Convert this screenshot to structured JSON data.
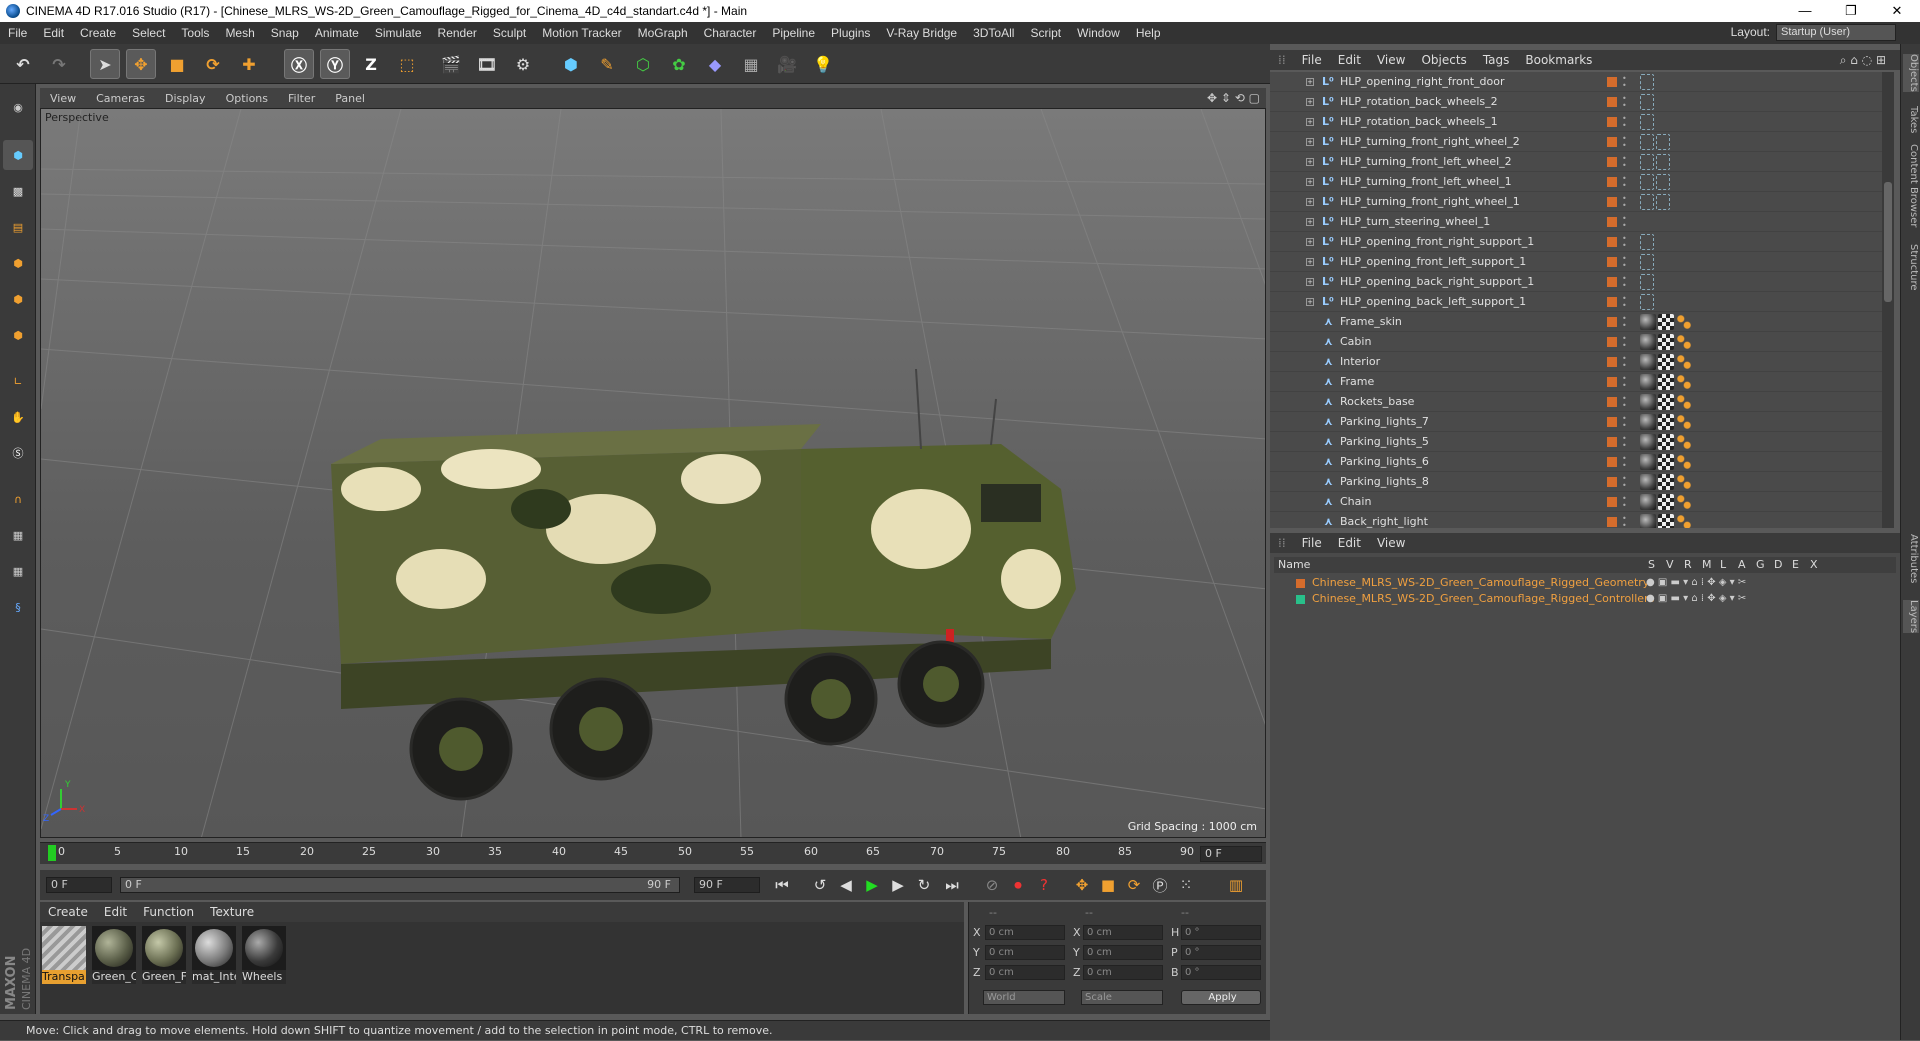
{
  "window": {
    "title": "CINEMA 4D R17.016 Studio (R17) - [Chinese_MLRS_WS-2D_Green_Camouflage_Rigged_for_Cinema_4D_c4d_standart.c4d *] - Main",
    "minimize": "—",
    "maximize": "❐",
    "close": "✕"
  },
  "menubar": {
    "items": [
      "File",
      "Edit",
      "Create",
      "Select",
      "Tools",
      "Mesh",
      "Snap",
      "Animate",
      "Simulate",
      "Render",
      "Sculpt",
      "Motion Tracker",
      "MoGraph",
      "Character",
      "Pipeline",
      "Plugins",
      "V-Ray Bridge",
      "3DToAll",
      "Script",
      "Window",
      "Help"
    ],
    "layout_label": "Layout:",
    "layout_value": "Startup (User)"
  },
  "viewport": {
    "menu": [
      "View",
      "Cameras",
      "Display",
      "Options",
      "Filter",
      "Panel"
    ],
    "name": "Perspective",
    "grid_spacing": "Grid Spacing : 1000 cm",
    "axis_y": "Y",
    "axis_x": "X",
    "axis_z": "Z"
  },
  "timeline": {
    "ticks": [
      "0",
      "5",
      "10",
      "15",
      "20",
      "25",
      "30",
      "35",
      "40",
      "45",
      "50",
      "55",
      "60",
      "65",
      "70",
      "75",
      "80",
      "85",
      "90"
    ],
    "current_frame": "0 F",
    "start": "0 F",
    "range_start": "0 F",
    "range_end": "90 F",
    "end": "90 F"
  },
  "materials": {
    "menu": [
      "Create",
      "Edit",
      "Function",
      "Texture"
    ],
    "items": [
      {
        "label": "Transpa",
        "color": "#d8d8d8"
      },
      {
        "label": "Green_C",
        "color": "#5a5e48"
      },
      {
        "label": "Green_F",
        "color": "#6a6e52"
      },
      {
        "label": "mat_Inte",
        "color": "#7a7a7a"
      },
      {
        "label": "Wheels",
        "color": "#3a3a3a"
      }
    ]
  },
  "coordinates": {
    "headers": [
      "--",
      "--",
      "--"
    ],
    "rows": [
      {
        "a": "X",
        "av": "0 cm",
        "b": "X",
        "bv": "0 cm",
        "c": "H",
        "cv": "0 °"
      },
      {
        "a": "Y",
        "av": "0 cm",
        "b": "Y",
        "bv": "0 cm",
        "c": "P",
        "cv": "0 °"
      },
      {
        "a": "Z",
        "av": "0 cm",
        "b": "Z",
        "bv": "0 cm",
        "c": "B",
        "cv": "0 °"
      }
    ],
    "mode1": "World",
    "mode2": "Scale",
    "apply": "Apply"
  },
  "branding": {
    "maxon": "MAXON",
    "c4d": "CINEMA 4D"
  },
  "status": "Move: Click and drag to move elements. Hold down SHIFT to quantize movement / add to the selection in point mode, CTRL to remove.",
  "objects": {
    "menu": [
      "File",
      "Edit",
      "View",
      "Objects",
      "Tags",
      "Bookmarks"
    ],
    "rows": [
      {
        "name": "HLP_opening_right_front_door",
        "type": "null",
        "tags": "dots"
      },
      {
        "name": "HLP_rotation_back_wheels_2",
        "type": "null",
        "tags": "dots"
      },
      {
        "name": "HLP_rotation_back_wheels_1",
        "type": "null",
        "tags": "dots"
      },
      {
        "name": "HLP_turning_front_right_wheel_2",
        "type": "null",
        "tags": "dots2"
      },
      {
        "name": "HLP_turning_front_left_wheel_2",
        "type": "null",
        "tags": "dots2"
      },
      {
        "name": "HLP_turning_front_left_wheel_1",
        "type": "null",
        "tags": "dots2"
      },
      {
        "name": "HLP_turning_front_right_wheel_1",
        "type": "null",
        "tags": "dots2"
      },
      {
        "name": "HLP_turn_steering_wheel_1",
        "type": "null",
        "tags": "none"
      },
      {
        "name": "HLP_opening_front_right_support_1",
        "type": "null",
        "tags": "dots"
      },
      {
        "name": "HLP_opening_front_left_support_1",
        "type": "null",
        "tags": "dots"
      },
      {
        "name": "HLP_opening_back_right_support_1",
        "type": "null",
        "tags": "dots"
      },
      {
        "name": "HLP_opening_back_left_support_1",
        "type": "null",
        "tags": "dots"
      },
      {
        "name": "Frame_skin",
        "type": "bone",
        "tags": "mat"
      },
      {
        "name": "Cabin",
        "type": "bone",
        "tags": "mat"
      },
      {
        "name": "Interior",
        "type": "bone",
        "tags": "mat"
      },
      {
        "name": "Frame",
        "type": "bone",
        "tags": "mat"
      },
      {
        "name": "Rockets_base",
        "type": "bone",
        "tags": "mat"
      },
      {
        "name": "Parking_lights_7",
        "type": "bone",
        "tags": "mat"
      },
      {
        "name": "Parking_lights_5",
        "type": "bone",
        "tags": "mat"
      },
      {
        "name": "Parking_lights_6",
        "type": "bone",
        "tags": "mat"
      },
      {
        "name": "Parking_lights_8",
        "type": "bone",
        "tags": "mat"
      },
      {
        "name": "Chain",
        "type": "bone",
        "tags": "mat"
      },
      {
        "name": "Back_right_light",
        "type": "bone",
        "tags": "mat"
      }
    ]
  },
  "layers": {
    "menu": [
      "File",
      "Edit",
      "View"
    ],
    "columns": [
      "Name",
      "S",
      "V",
      "R",
      "M",
      "L",
      "A",
      "G",
      "D",
      "E",
      "X"
    ],
    "rows": [
      {
        "name": "Chinese_MLRS_WS-2D_Green_Camouflage_Rigged_Geometry",
        "color": "#d56c2c"
      },
      {
        "name": "Chinese_MLRS_WS-2D_Green_Camouflage_Rigged_Controllers",
        "color": "#29c08a"
      }
    ]
  },
  "sidetabs": [
    "Objects",
    "Takes",
    "Content Browser",
    "Structure",
    "Attributes",
    "Layers"
  ]
}
